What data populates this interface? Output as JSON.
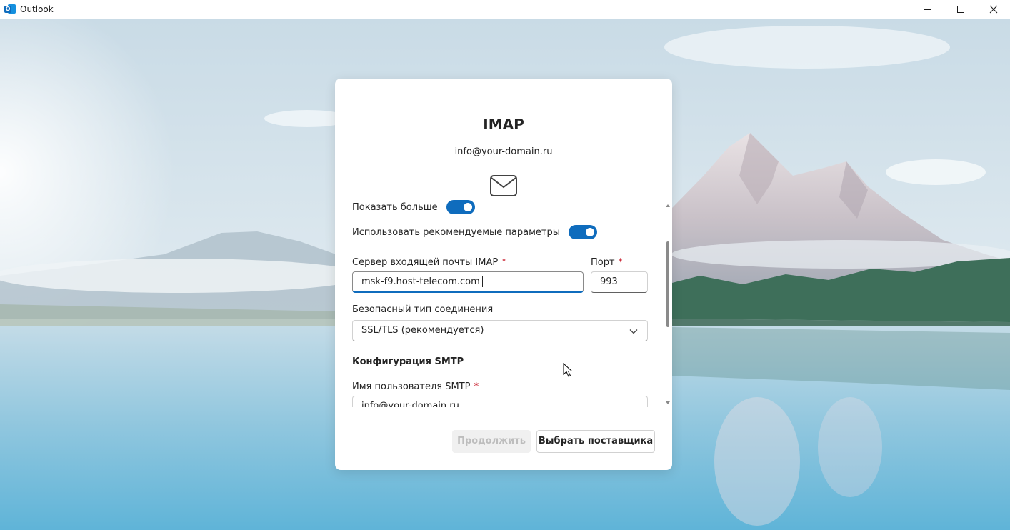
{
  "window": {
    "title": "Outlook",
    "app_icon": "outlook-icon",
    "app_icon_letter": "O",
    "controls": [
      "minimize-icon",
      "maximize-icon",
      "close-icon"
    ]
  },
  "dialog": {
    "title": "IMAP",
    "email": "info@your-domain.ru",
    "header_icon": "mail-icon",
    "show_more": {
      "label": "Показать больше",
      "on": true
    },
    "use_recommended": {
      "label": "Использовать рекомендуемые параметры",
      "on": true
    },
    "imap_server": {
      "label": "Сервер входящей почты IMAP",
      "required_mark": "*",
      "value": "msk-f9.host-telecom.com"
    },
    "port": {
      "label": "Порт",
      "required_mark": "*",
      "value": "993"
    },
    "security": {
      "label": "Безопасный тип соединения",
      "value": "SSL/TLS (рекомендуется)"
    },
    "smtp_section_title": "Конфигурация SMTP",
    "smtp_username": {
      "label": "Имя пользователя SMTP",
      "required_mark": "*",
      "value": "info@your-domain.ru"
    },
    "buttons": {
      "continue": "Продолжить",
      "choose_provider": "Выбрать поставщика"
    }
  },
  "colors": {
    "accent": "#0f6cbd",
    "required": "#c50f1f",
    "disabled_text": "#bdbdbd"
  }
}
